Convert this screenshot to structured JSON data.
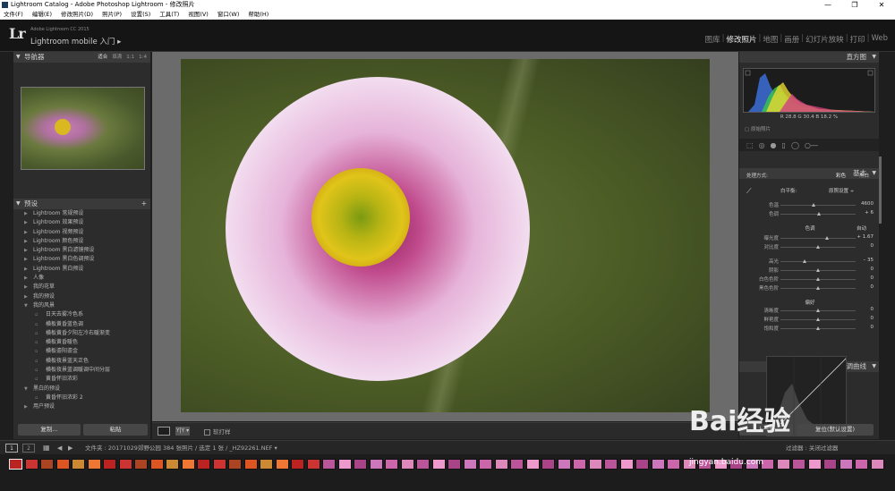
{
  "window": {
    "title": "Lightroom Catalog - Adobe Photoshop Lightroom - 修改照片",
    "controls": [
      "—",
      "❐",
      "✕"
    ]
  },
  "menu": [
    "文件(F)",
    "编辑(E)",
    "修改照片(D)",
    "照片(P)",
    "设置(S)",
    "工具(T)",
    "视图(V)",
    "窗口(W)",
    "帮助(H)"
  ],
  "header": {
    "logo": "Lr",
    "version": "Adobe Lightroom CC 2015",
    "mobile": "Lightroom mobile 入门 ▸"
  },
  "modules": [
    "图库",
    "修改照片",
    "地图",
    "画册",
    "幻灯片放映",
    "打印",
    "Web"
  ],
  "active_module": "修改照片",
  "navigator": {
    "title": "导航器",
    "options": [
      "适合",
      "填满",
      "1:1",
      "1:4"
    ]
  },
  "presets": {
    "title": "预设",
    "add": "+",
    "items": [
      {
        "label": "Lightroom 常规预设",
        "level": "top",
        "tri": "▶"
      },
      {
        "label": "Lightroom 效果预设",
        "level": "top",
        "tri": "▶"
      },
      {
        "label": "Lightroom 视频预设",
        "level": "top",
        "tri": "▶"
      },
      {
        "label": "Lightroom 颜色预设",
        "level": "top",
        "tri": "▶"
      },
      {
        "label": "Lightroom 黑白滤镜预设",
        "level": "top",
        "tri": "▶"
      },
      {
        "label": "Lightroom 黑白色调预设",
        "level": "top",
        "tri": "▶"
      },
      {
        "label": "Lightroom 黑白预设",
        "level": "top",
        "tri": "▶"
      },
      {
        "label": "人像",
        "level": "top",
        "tri": "▶"
      },
      {
        "label": "我的花草",
        "level": "top",
        "tri": "▶"
      },
      {
        "label": "我的预设",
        "level": "top",
        "tri": "▶"
      },
      {
        "label": "我的风景",
        "level": "top",
        "tri": "▼"
      },
      {
        "label": "日天去雾冷色系",
        "level": "sub",
        "tri": "▫"
      },
      {
        "label": "横板黄昏蓝色调",
        "level": "sub",
        "tri": "▫"
      },
      {
        "label": "横板黄昏夕阳左冷右暖渐变",
        "level": "sub",
        "tri": "▫"
      },
      {
        "label": "横板黄昏暖色",
        "level": "sub",
        "tri": "▫"
      },
      {
        "label": "横板鎏阳鎏金",
        "level": "sub",
        "tri": "▫"
      },
      {
        "label": "横板夜景蓝天正色",
        "level": "sub",
        "tri": "▫"
      },
      {
        "label": "横板夜景蓝调暖调中间分层",
        "level": "sub",
        "tri": "▫"
      },
      {
        "label": "黄昏怀旧浓彩",
        "level": "sub",
        "tri": "▫"
      },
      {
        "label": "黑白的预设",
        "level": "top",
        "tri": "▼"
      },
      {
        "label": "黄昏怀旧浓彩 2",
        "level": "sub",
        "tri": "▫"
      },
      {
        "label": "用户预设",
        "level": "top",
        "tri": "▶"
      }
    ]
  },
  "left_buttons": {
    "copy": "复制...",
    "paste": "粘贴"
  },
  "toolbar": {
    "compare": "Y|Y ▾",
    "softproof": "软打样"
  },
  "histogram": {
    "title": "直方图",
    "info": "R  28.8   G  30.4   B  18.2  %",
    "original": "原始照片"
  },
  "basic": {
    "title": "基本",
    "treatment_label": "处理方式:",
    "treatment_options": [
      "彩色",
      "黑白"
    ],
    "wb_label": "白平衡:",
    "wb_value": "原照设置 ÷",
    "tone_label": "色调",
    "auto": "自动",
    "presence_label": "偏好",
    "sliders": [
      {
        "name": "色温",
        "value": "4600",
        "pos": 0.45
      },
      {
        "name": "色调",
        "value": "+ 6",
        "pos": 0.52
      },
      {
        "name": "曝光度",
        "value": "+ 1.67",
        "pos": 0.62
      },
      {
        "name": "对比度",
        "value": "0",
        "pos": 0.5
      },
      {
        "name": "高光",
        "value": "– 35",
        "pos": 0.33
      },
      {
        "name": "阴影",
        "value": "0",
        "pos": 0.5
      },
      {
        "name": "白色色阶",
        "value": "0",
        "pos": 0.5
      },
      {
        "name": "黑色色阶",
        "value": "0",
        "pos": 0.5
      },
      {
        "name": "清晰度",
        "value": "0",
        "pos": 0.5
      },
      {
        "name": "鲜艳度",
        "value": "0",
        "pos": 0.5
      },
      {
        "name": "饱和度",
        "value": "0",
        "pos": 0.5
      }
    ]
  },
  "tonecurve": {
    "title": "色调曲线"
  },
  "right_buttons": {
    "previous": "上一张",
    "reset": "复位(默认设置)"
  },
  "filmbar": {
    "page1": "1",
    "page2": "2",
    "source": "文件夹 : 20171029郊野公园   384 张照片 / 选定 1 张 / _HZ92261.NEF ▾",
    "filter": "过滤器 :   关闭过滤器"
  },
  "watermark": {
    "text": "Bai经验",
    "url": "jingyan.baidu.com"
  },
  "colors": {
    "accent": "#eeeeee",
    "panel": "#2c2c2c",
    "center": "#6b6b6b"
  }
}
